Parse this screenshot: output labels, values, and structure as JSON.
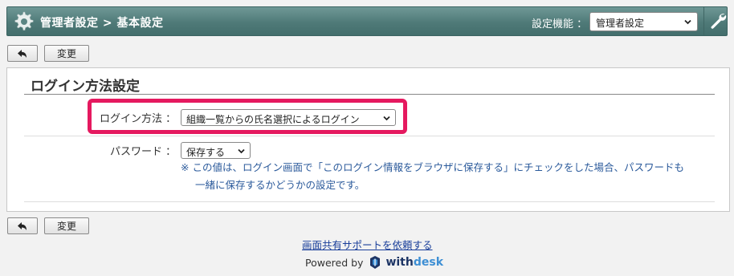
{
  "header": {
    "breadcrumb": "管理者設定 > 基本設定",
    "setting_label": "設定機能 ：",
    "setting_select_value": "管理者設定"
  },
  "toolbar": {
    "change_label": "変更"
  },
  "panel": {
    "title": "ログイン方法設定",
    "login_method": {
      "label": "ログイン方法 ：",
      "value": "組織一覧からの氏名選択によるログイン"
    },
    "password": {
      "label": "パスワード ：",
      "value": "保存する"
    },
    "note_line1": "※ この値は、ログイン画面で「このログイン情報をブラウザに保存する」にチェックをした場合、パスワードも",
    "note_line2": "一緒に保存するかどうかの設定です。"
  },
  "footer": {
    "support_link": "画面共有サポートを依頼する",
    "powered_by": "Powered by",
    "logo_with": "with",
    "logo_desk": "desk"
  },
  "colors": {
    "header_bg": "#557f7d",
    "highlight_border": "#e5195f",
    "note_text": "#2b5a9b",
    "link": "#1a3f9a"
  }
}
